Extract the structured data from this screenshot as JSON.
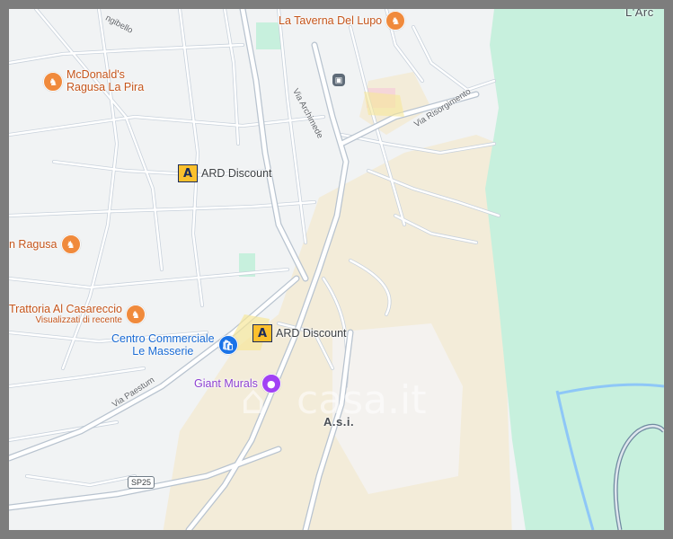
{
  "map": {
    "colors": {
      "land": "#f1f3f4",
      "park": "#c7f0dd",
      "urban_sand": "#f3ecd9",
      "road": "#ffffff",
      "road_edge": "#c9d2dc",
      "water": "#8ec7f7"
    },
    "pois": {
      "taverna": {
        "label": "La Taverna Del Lupo",
        "icon": "restaurant-icon"
      },
      "mcdonalds": {
        "label_line1": "McDonald's",
        "label_line2": "Ragusa La Pira",
        "icon": "restaurant-icon"
      },
      "ard1": {
        "label": "ARD Discount",
        "icon": "ard-logo-icon"
      },
      "ard2": {
        "label": "ARD Discount",
        "icon": "ard-logo-icon"
      },
      "ragusa": {
        "label": "n Ragusa",
        "icon": "restaurant-icon"
      },
      "trattoria": {
        "label": "Trattoria Al Casareccio",
        "sublabel": "Visualizzati di recente",
        "icon": "restaurant-icon"
      },
      "centro": {
        "label_line1": "Centro Commerciale",
        "label_line2": "Le Masserie",
        "icon": "shopping-bag-icon"
      },
      "murals": {
        "label": "Giant Murals",
        "icon": "palette-icon"
      }
    },
    "roads": {
      "via_archimede": "Via Archimede",
      "via_risorgimento": "Via Risorgimento",
      "via_paestum": "Via Paestum",
      "via_top": "ngibello",
      "sp25": "SP25"
    },
    "areas": {
      "asi": "A.s.i.",
      "corner": "L'Arc"
    },
    "watermark": "casa.it"
  }
}
